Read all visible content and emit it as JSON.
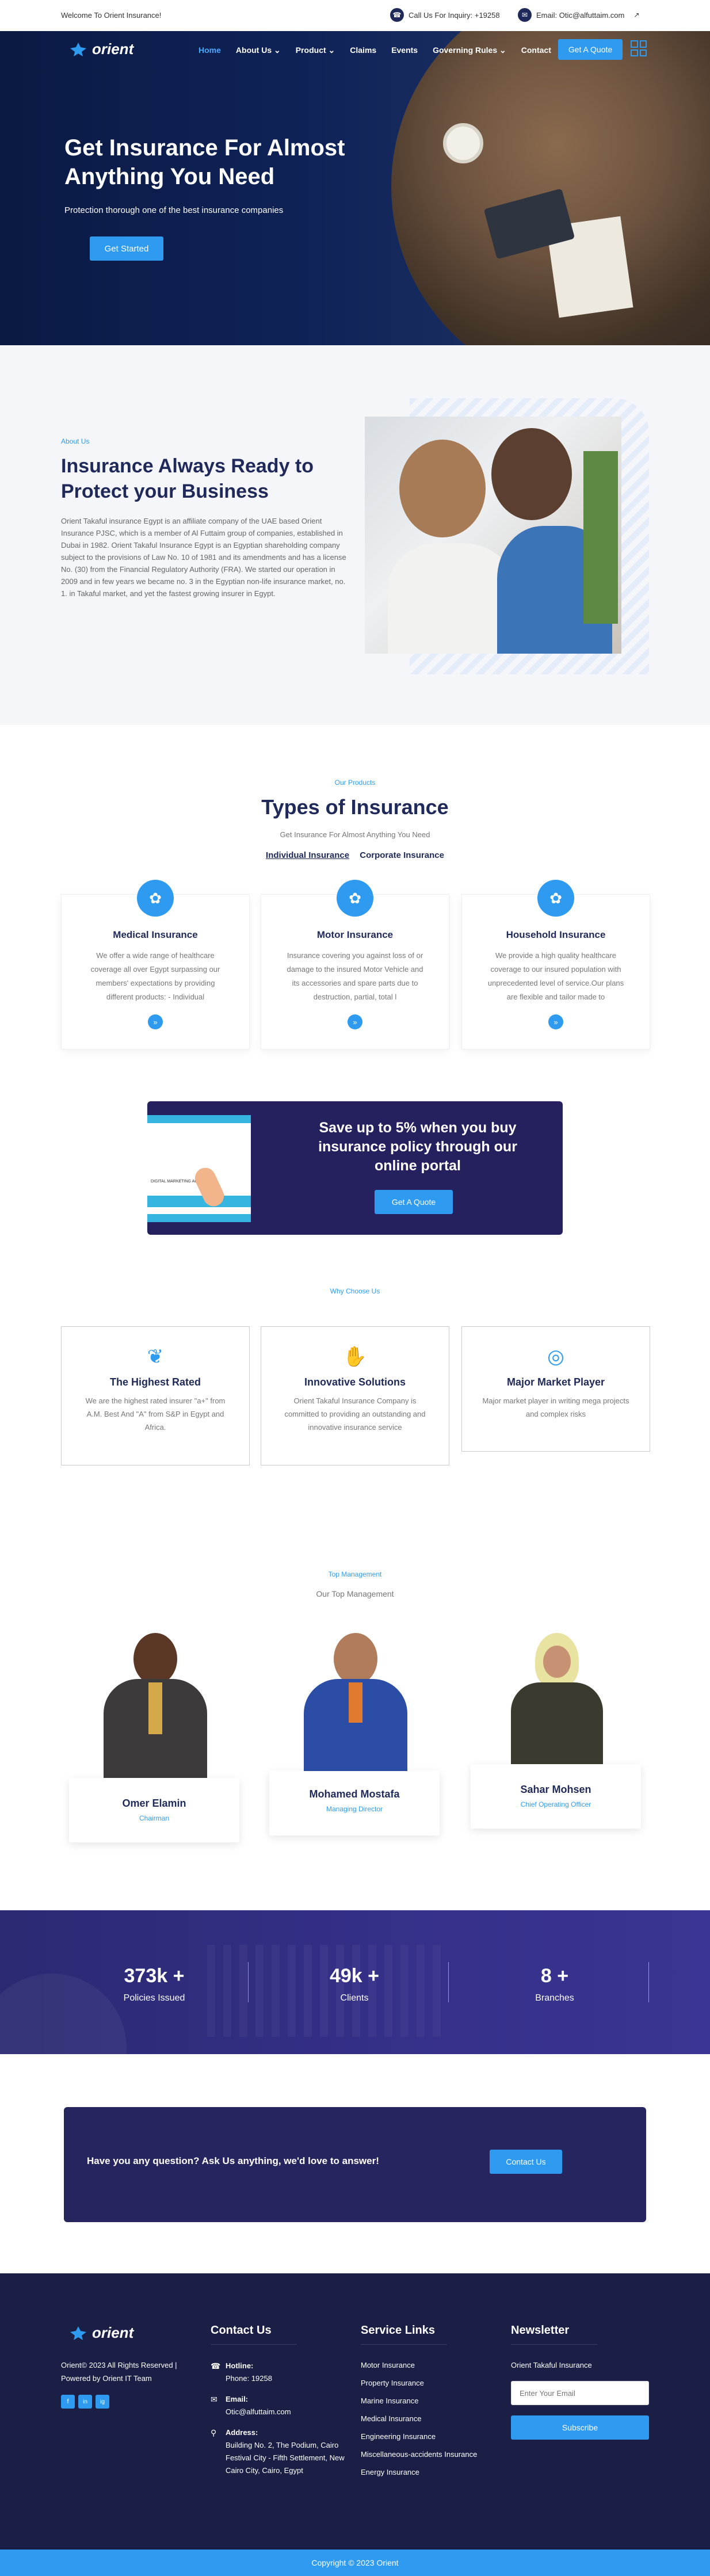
{
  "topbar": {
    "welcome": "Welcome To Orient Insurance!",
    "phone": "Call Us For Inquiry: +19258",
    "email": "Email: Otic@alfuttaim.com",
    "link_icon": "external-link-icon"
  },
  "header": {
    "logo_text": "orient",
    "nav": [
      "Home",
      "About Us",
      "Product",
      "Claims",
      "Events",
      "Governing Rules",
      "Contact"
    ],
    "nav_dropdowns": [
      false,
      true,
      true,
      false,
      false,
      true,
      false
    ],
    "quote_button": "Get A Quote"
  },
  "hero": {
    "title": "Get Insurance For Almost Anything You Need",
    "subtitle": "Protection thorough one of the best insurance companies",
    "cta": "Get Started"
  },
  "about": {
    "label": "About Us",
    "title": "Insurance Always Ready to Protect your Business",
    "text": "Orient Takaful insurance Egypt is an affiliate company of the UAE based Orient Insurance PJSC, which is a member of Al Futtaim group of companies, established in Dubai in 1982. Orient Takaful Insurance Egypt is an Egyptian shareholding company subject to the provisions of Law No. 10 of 1981 and its amendments and has a license No. (30) from the Financial Regulatory Authority (FRA). We started our operation in 2009 and in few years we became no. 3 in the Egyptian non-life insurance market, no. 1. in Takaful market, and yet the fastest growing insurer in Egypt."
  },
  "products": {
    "label": "Our Products",
    "title": "Types of Insurance",
    "subtitle": "Get Insurance For Almost Anything You Need",
    "tabs": [
      "Individual Insurance",
      "Corporate Insurance"
    ],
    "cards": [
      {
        "title": "Medical Insurance",
        "text": "We offer a wide range of healthcare coverage all over Egypt surpassing our members' expectations by providing different products: - Individual"
      },
      {
        "title": "Motor Insurance",
        "text": "Insurance covering you against loss of or damage to the insured Motor Vehicle and its accessories and spare parts due to destruction, partial, total l"
      },
      {
        "title": "Household Insurance",
        "text": "We provide a high quality healthcare coverage to our insured population with unprecedented level of service.Our plans are flexible and tailor made to"
      }
    ]
  },
  "promo": {
    "title": "Save up to 5% when you buy insurance policy through our online portal",
    "button": "Get A Quote",
    "image_caption": "DIGITAL MARKETING AGENCY OF..."
  },
  "why": {
    "label": "Why Choose Us",
    "cards": [
      {
        "title": "The Highest Rated",
        "text": "We are the highest rated insurer \"a+\" from A.M. Best And \"A\" from S&P in Egypt and Africa."
      },
      {
        "title": "Innovative Solutions",
        "text": "Orient Takaful Insurance Company is committed to providing an outstanding and innovative insurance service"
      },
      {
        "title": "Major Market Player",
        "text": "Major market player in writing mega projects and complex risks"
      }
    ]
  },
  "management": {
    "label": "Top Management",
    "subtitle": "Our Top Management",
    "people": [
      {
        "name": "Omer Elamin",
        "role": "Chairman"
      },
      {
        "name": "Mohamed Mostafa",
        "role": "Managing Director"
      },
      {
        "name": "Sahar Mohsen",
        "role": "Chief Operating Officer"
      }
    ]
  },
  "stats": [
    {
      "value": "373k +",
      "label": "Policies Issued"
    },
    {
      "value": "49k +",
      "label": "Clients"
    },
    {
      "value": "8 +",
      "label": "Branches"
    }
  ],
  "cta": {
    "text": "Have you any question? Ask Us anything, we'd love to answer!",
    "button": "Contact Us"
  },
  "footer": {
    "logo_text": "orient",
    "copy": "Orient© 2023 All Rights Reserved | Powered by Orient IT Team",
    "contact_title": "Contact Us",
    "hotline_label": "Hotline:",
    "hotline_value": "Phone: 19258",
    "email_label": "Email:",
    "email_value": "Otic@alfuttaim.com",
    "address_label": "Address:",
    "address_value": "Building No. 2, The Podium, Cairo Festival City - Fifth Settlement, New Cairo City, Cairo, Egypt",
    "services_title": "Service Links",
    "services": [
      "Motor Insurance",
      "Property Insurance",
      "Marine Insurance",
      "Medical Insurance",
      "Engineering Insurance",
      "Miscellaneous-accidents Insurance",
      "Energy Insurance"
    ],
    "newsletter_title": "Newsletter",
    "newsletter_text": "Orient Takaful Insurance",
    "email_placeholder": "Enter Your Email",
    "subscribe": "Subscribe",
    "social": [
      "f",
      "in",
      "ig"
    ]
  },
  "copyright": "Copyright © 2023 Orient",
  "colors": {
    "accent": "#2f9bf0",
    "navy": "#1f2a5a",
    "dark": "#1c1f45",
    "promo": "#25205e"
  }
}
